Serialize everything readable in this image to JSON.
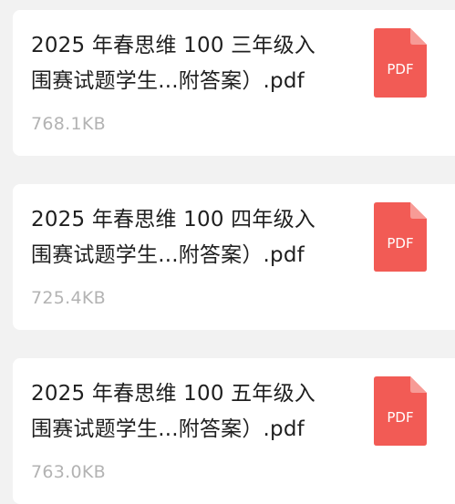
{
  "files": [
    {
      "name_line1": "2025 年春思维 100 三年级入",
      "name_line2": "围赛试题学生...附答案）.pdf",
      "size": "768.1KB",
      "icon": "pdf-file-icon",
      "icon_label": "PDF"
    },
    {
      "name_line1": "2025 年春思维 100 四年级入",
      "name_line2": "围赛试题学生...附答案）.pdf",
      "size": "725.4KB",
      "icon": "pdf-file-icon",
      "icon_label": "PDF"
    },
    {
      "name_line1": "2025 年春思维 100 五年级入",
      "name_line2": "围赛试题学生...附答案）.pdf",
      "size": "763.0KB",
      "icon": "pdf-file-icon",
      "icon_label": "PDF"
    }
  ],
  "colors": {
    "pdf_red": "#f25b55",
    "pdf_fold": "#f79b96",
    "title_text": "#1f1f1f",
    "size_text": "#b3b3b3",
    "background": "#f2f2f2",
    "card": "#ffffff"
  }
}
